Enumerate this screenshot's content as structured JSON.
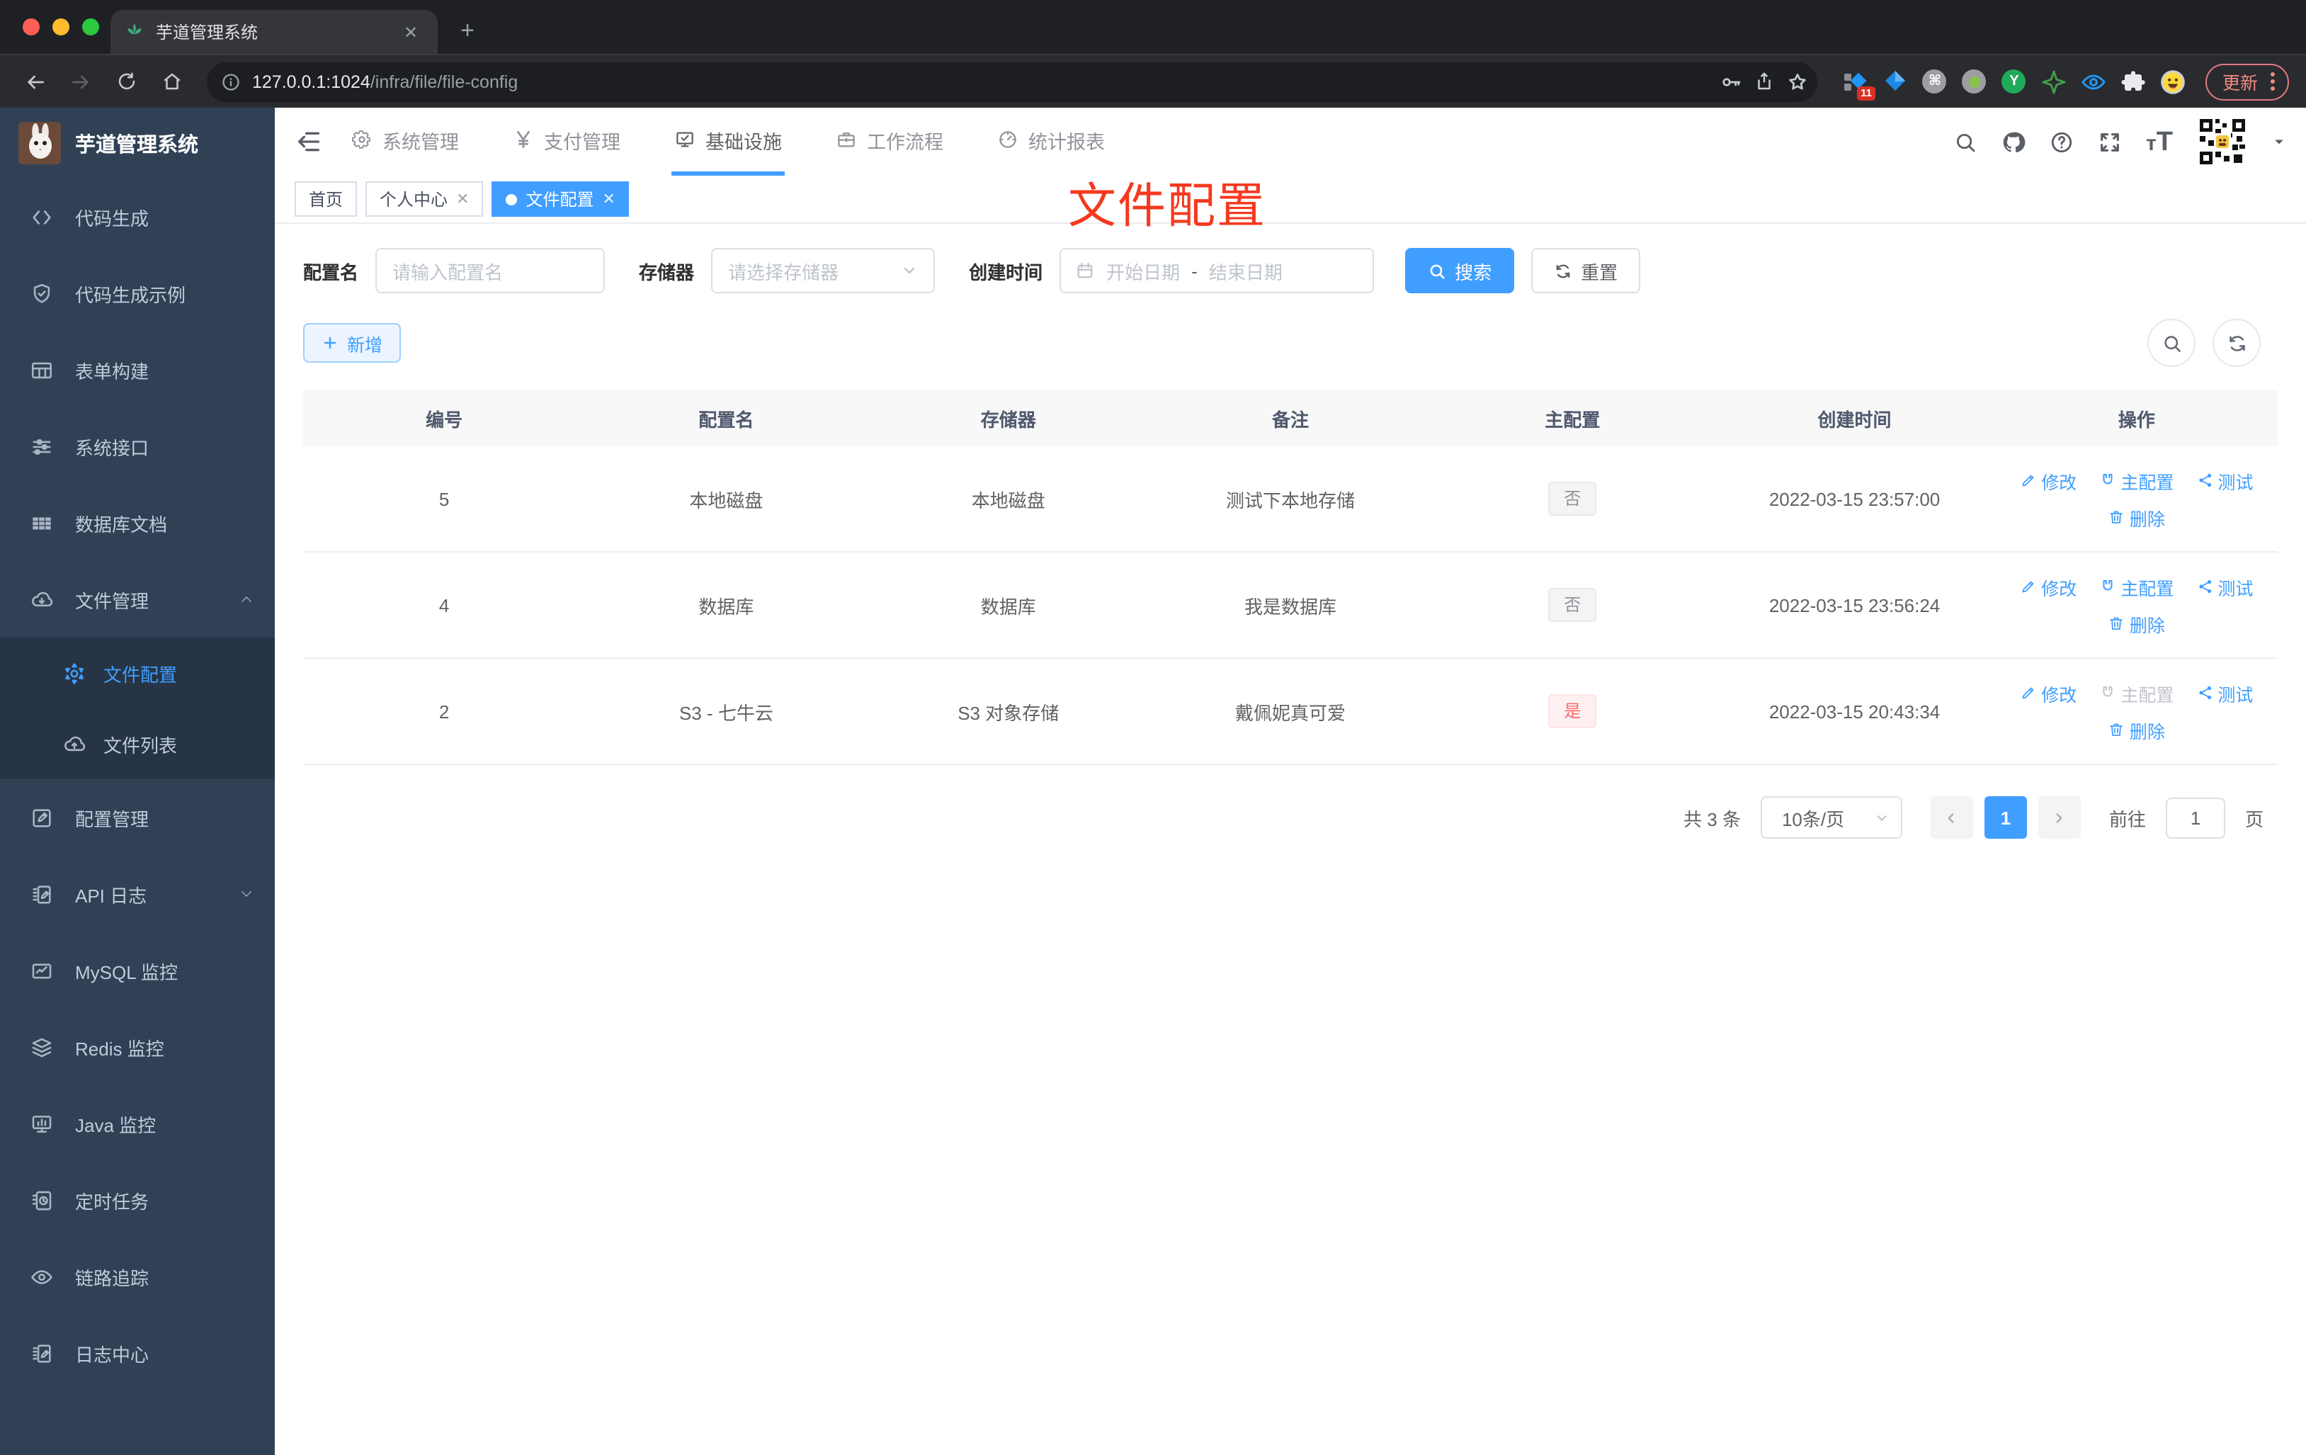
{
  "browser": {
    "tab_title": "芋道管理系统",
    "url_host": "127.0.0.1:1024",
    "url_path": "/infra/file/file-config",
    "update_label": "更新",
    "extensions": [
      {
        "key": "tampermonkey",
        "name": "tampermonkey-icon",
        "badge": "11"
      },
      {
        "key": "kite",
        "name": "kite-icon"
      },
      {
        "key": "cmd",
        "name": "cmd-circle-icon",
        "glyph": "⌘",
        "bg": "#9e9ea2"
      },
      {
        "key": "dot",
        "name": "dot-circle-icon",
        "bg": "#9e9ea2"
      },
      {
        "key": "y",
        "name": "y-circle-icon",
        "glyph": "Y",
        "bg": "#1faa59"
      },
      {
        "key": "star",
        "name": "green-star-icon"
      },
      {
        "key": "eye",
        "name": "blue-eye-icon"
      },
      {
        "key": "puzzle",
        "name": "extensions-puzzle-icon"
      },
      {
        "key": "emoji",
        "name": "emoji-avatar-icon"
      }
    ]
  },
  "sidebar": {
    "app_title": "芋道管理系统",
    "items": [
      {
        "key": "code-gen",
        "label": "代码生成",
        "icon": "code"
      },
      {
        "key": "code-demo",
        "label": "代码生成示例",
        "icon": "shield"
      },
      {
        "key": "form-builder",
        "label": "表单构建",
        "icon": "formgrid"
      },
      {
        "key": "system-api",
        "label": "系统接口",
        "icon": "sliders"
      },
      {
        "key": "db-doc",
        "label": "数据库文档",
        "icon": "tablefill"
      },
      {
        "key": "file-manage",
        "label": "文件管理",
        "icon": "clouddown",
        "expanded": true,
        "children": [
          {
            "key": "file-config",
            "label": "文件配置",
            "icon": "gear",
            "active": true
          },
          {
            "key": "file-list",
            "label": "文件列表",
            "icon": "cloudup"
          }
        ]
      },
      {
        "key": "config-manage",
        "label": "配置管理",
        "icon": "editsq"
      },
      {
        "key": "api-log",
        "label": "API 日志",
        "icon": "docedit",
        "collapsed": true
      },
      {
        "key": "mysql-monitor",
        "label": "MySQL 监控",
        "icon": "chart"
      },
      {
        "key": "redis-monitor",
        "label": "Redis 监控",
        "icon": "layers"
      },
      {
        "key": "java-monitor",
        "label": "Java 监控",
        "icon": "monitor"
      },
      {
        "key": "cron-job",
        "label": "定时任务",
        "icon": "timer"
      },
      {
        "key": "trace",
        "label": "链路追踪",
        "icon": "eye"
      },
      {
        "key": "log-center",
        "label": "日志中心",
        "icon": "docedit"
      }
    ]
  },
  "topnav": {
    "menus": [
      {
        "key": "system",
        "label": "系统管理",
        "icon": "gearfill"
      },
      {
        "key": "payment",
        "label": "支付管理",
        "icon": "yen"
      },
      {
        "key": "infra",
        "label": "基础设施",
        "icon": "infra",
        "active": true
      },
      {
        "key": "workflow",
        "label": "工作流程",
        "icon": "briefcase"
      },
      {
        "key": "report",
        "label": "统计报表",
        "icon": "dashboard"
      }
    ]
  },
  "tags": [
    {
      "key": "home",
      "label": "首页",
      "closable": false,
      "active": false
    },
    {
      "key": "profile",
      "label": "个人中心",
      "closable": true,
      "active": false
    },
    {
      "key": "file-config",
      "label": "文件配置",
      "closable": true,
      "active": true
    }
  ],
  "annotation": "文件配置",
  "filters": {
    "name_label": "配置名",
    "name_placeholder": "请输入配置名",
    "storage_label": "存储器",
    "storage_placeholder": "请选择存储器",
    "date_label": "创建时间",
    "date_start_placeholder": "开始日期",
    "date_separator": "-",
    "date_end_placeholder": "结束日期",
    "search_label": "搜索",
    "reset_label": "重置"
  },
  "toolbar": {
    "add_label": "新增"
  },
  "table": {
    "headers": [
      "编号",
      "配置名",
      "存储器",
      "备注",
      "主配置",
      "创建时间",
      "操作"
    ],
    "action_labels": {
      "edit": "修改",
      "master": "主配置",
      "test": "测试",
      "delete": "删除"
    },
    "rows": [
      {
        "id": "5",
        "name": "本地磁盘",
        "storage": "本地磁盘",
        "remark": "测试下本地存储",
        "master": "否",
        "master_type": "info",
        "created": "2022-03-15 23:57:00",
        "master_disabled": false
      },
      {
        "id": "4",
        "name": "数据库",
        "storage": "数据库",
        "remark": "我是数据库",
        "master": "否",
        "master_type": "info",
        "created": "2022-03-15 23:56:24",
        "master_disabled": false
      },
      {
        "id": "2",
        "name": "S3 - 七牛云",
        "storage": "S3 对象存储",
        "remark": "戴佩妮真可爱",
        "master": "是",
        "master_type": "danger",
        "created": "2022-03-15 20:43:34",
        "master_disabled": true
      }
    ]
  },
  "pagination": {
    "total": "共 3 条",
    "page_size": "10条/页",
    "current_page": "1",
    "goto_label": "前往",
    "goto_value": "1",
    "page_unit": "页"
  },
  "colors": {
    "accent": "#409eff",
    "sidebar": "#304156",
    "danger": "#f56c6c",
    "annotation_red": "#f5391f"
  }
}
